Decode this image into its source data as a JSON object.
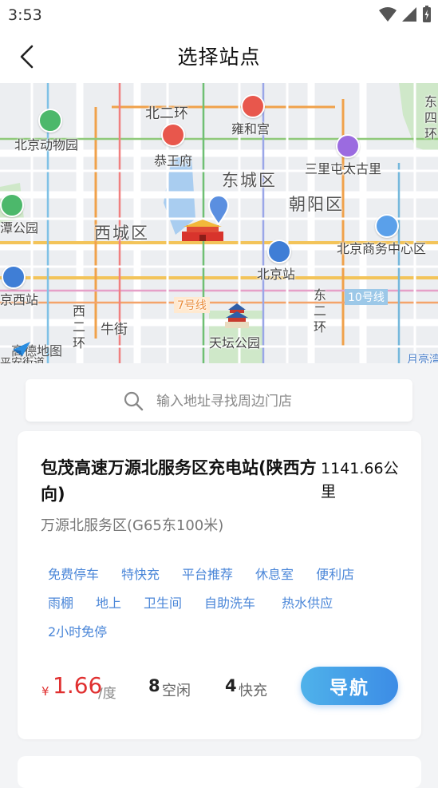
{
  "status_bar": {
    "time": "3:53"
  },
  "header": {
    "title": "选择站点"
  },
  "map": {
    "labels": {
      "beierhuan": "北二环",
      "yonghegong": "雍和宫",
      "zoo": "北京动物园",
      "gongwangfu": "恭王府",
      "dongcheng": "东城区",
      "sanlitun": "三里屯太古里",
      "chaoyang": "朝阳区",
      "xicheng": "西城区",
      "yuyuantan": "潭公园",
      "cbd": "北京商务中心区",
      "bjstation": "北京站",
      "bjwest": "京西站",
      "line7": "7号线",
      "line10": "10号线",
      "dongerhuan": "东二环",
      "xierhuan": "西二环",
      "niujie": "牛街",
      "tiantan": "天坛公园",
      "yuetan": "月亮湾",
      "east_edge": "东四环",
      "sw_edge": "平安街道"
    },
    "attribution": "高德地图"
  },
  "search": {
    "placeholder": "输入地址寻找周边门店",
    "value": ""
  },
  "station": {
    "name": "包茂高速万源北服务区充电站(陕西方向)",
    "distance": "1141.66公里",
    "address": "万源北服务区(G65东100米)",
    "tags": [
      "免费停车",
      "特快充",
      "平台推荐",
      "休息室",
      "便利店",
      "雨棚",
      "地上",
      "卫生间",
      "自助洗车",
      "热水供应",
      "2小时免停"
    ],
    "currency": "¥",
    "price": "1.66",
    "price_unit": "/度",
    "idle_count": "8",
    "idle_label": "空闲",
    "fast_count": "4",
    "fast_label": "快充",
    "nav_label": "导航"
  },
  "colors": {
    "accent": "#3c8ce6",
    "price": "#e03030",
    "tag": "#4a86d8"
  }
}
